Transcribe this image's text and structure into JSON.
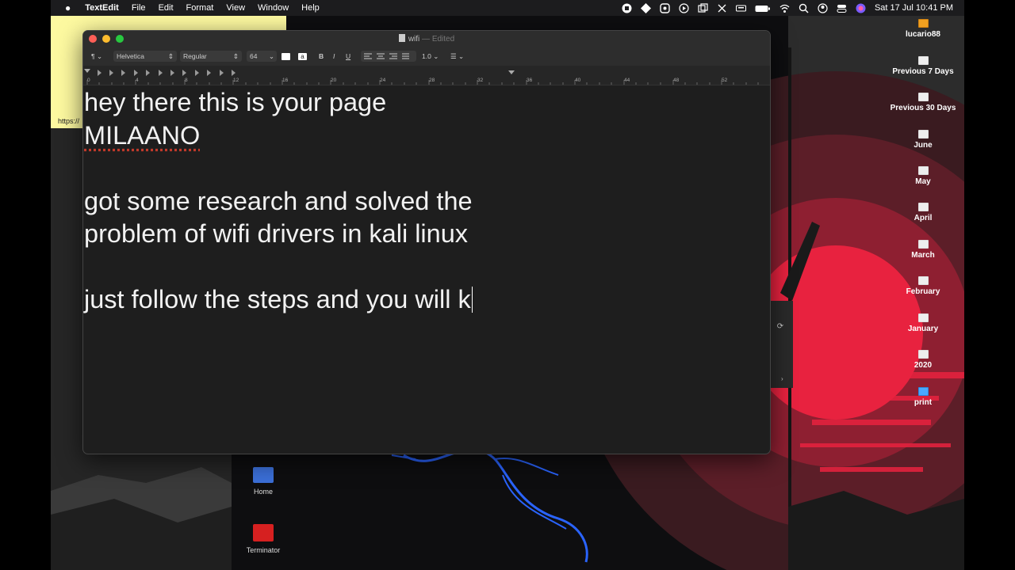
{
  "menubar": {
    "app_name": "TextEdit",
    "items": [
      "File",
      "Edit",
      "Format",
      "View",
      "Window",
      "Help"
    ],
    "clock": "Sat 17 Jul  10:41 PM"
  },
  "sticky": {
    "url": "https://"
  },
  "desktop_items": [
    {
      "label": "lucario88",
      "icon": "drive-icon"
    },
    {
      "label": "Previous 7 Days",
      "icon": "smart-folder-icon"
    },
    {
      "label": "Previous 30 Days",
      "icon": "smart-folder-icon"
    },
    {
      "label": "June",
      "icon": "folder-icon"
    },
    {
      "label": "May",
      "icon": "folder-icon"
    },
    {
      "label": "April",
      "icon": "folder-icon"
    },
    {
      "label": "March",
      "icon": "folder-icon"
    },
    {
      "label": "February",
      "icon": "folder-icon"
    },
    {
      "label": "January",
      "icon": "folder-icon"
    },
    {
      "label": "2020",
      "icon": "folder-icon"
    },
    {
      "label": "print",
      "icon": "folder-icon"
    }
  ],
  "kali_icons": [
    {
      "label": "Home",
      "icon": "home-folder-icon"
    },
    {
      "label": "Terminator",
      "icon": "terminal-icon"
    }
  ],
  "window": {
    "title": "wifi",
    "status": "Edited",
    "toolbar": {
      "paragraph_style": "¶",
      "font_family": "Helvetica",
      "font_style": "Regular",
      "font_size": "64",
      "text_color_glyph": "a",
      "bold": "B",
      "italic": "I",
      "underline": "U",
      "line_spacing": "1.0"
    },
    "ruler_labels": [
      "0",
      "4",
      "8",
      "12",
      "16",
      "20",
      "24",
      "28",
      "32",
      "36",
      "40",
      "44",
      "48",
      "52"
    ],
    "document_lines": [
      "hey there this is your page",
      "MILAANO",
      "",
      "got some research and solved the",
      "problem of wifi drivers in kali linux",
      "",
      "just follow the steps and you will k"
    ]
  },
  "colors": {
    "sticky": "#fdf9a0",
    "window_bg": "#1e1e1e",
    "accent_red": "#e8223f",
    "kali_blue": "#2a64ff"
  }
}
